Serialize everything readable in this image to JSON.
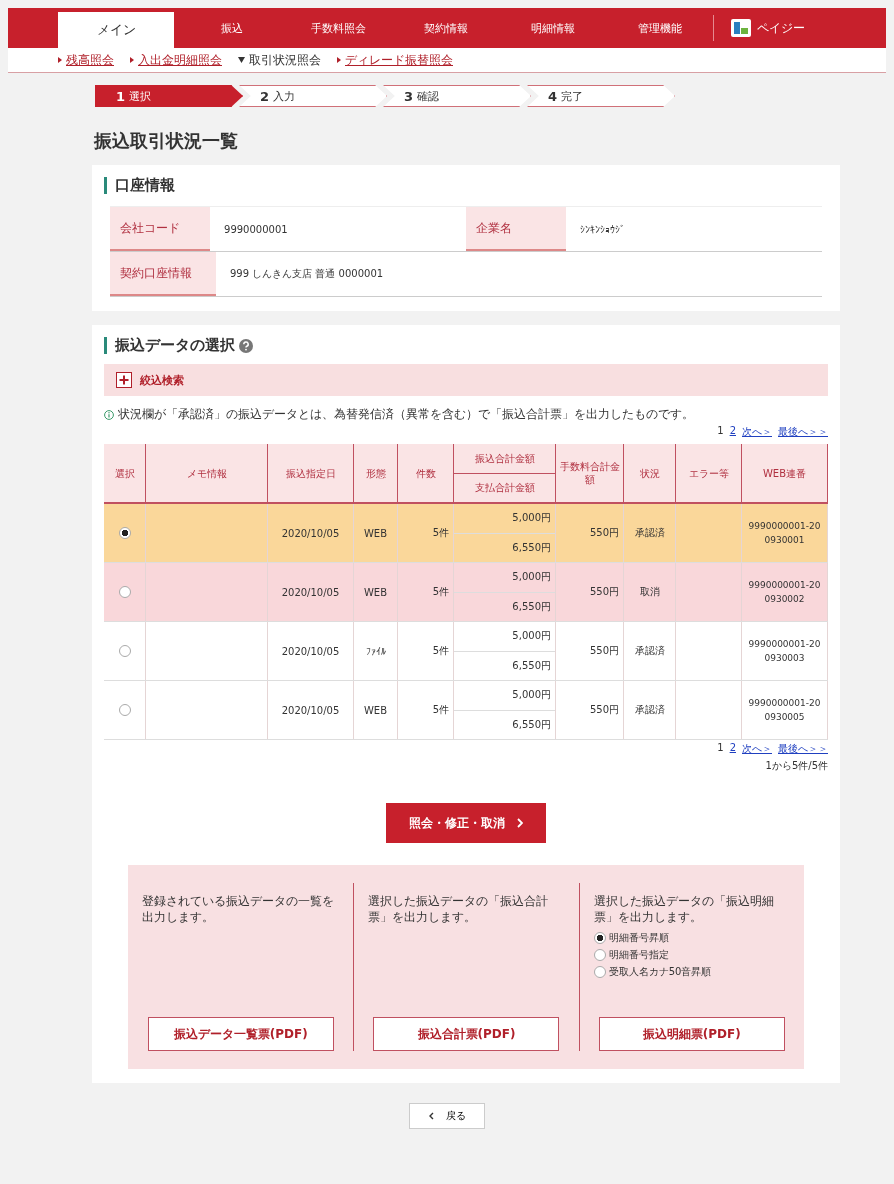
{
  "nav": [
    {
      "label": "メイン",
      "selected": true
    },
    {
      "label": "振込",
      "selected": false
    },
    {
      "label": "手数料照会",
      "selected": false
    },
    {
      "label": "契約情報",
      "selected": false
    },
    {
      "label": "明細情報",
      "selected": false
    },
    {
      "label": "管理機能",
      "selected": false
    }
  ],
  "nav_pay": {
    "label": "ペイジー"
  },
  "subnav": [
    {
      "label": "残高照会",
      "selected": false
    },
    {
      "label": "入出金明細照会",
      "selected": false
    },
    {
      "label": "取引状況照会",
      "selected": true
    },
    {
      "label": "ディレード振替照会",
      "selected": false
    }
  ],
  "steps": [
    {
      "number": "1",
      "label": "選択",
      "selected": true
    },
    {
      "number": "2",
      "label": "入力",
      "selected": false
    },
    {
      "number": "3",
      "label": "確認",
      "selected": false
    },
    {
      "number": "4",
      "label": "完了",
      "selected": false
    }
  ],
  "page_title": "振込取引状況一覧",
  "account": {
    "title": "口座情報",
    "fields": [
      {
        "label": "会社コード",
        "value": "9990000001"
      },
      {
        "label": "企業名",
        "value": "ｼﾝｷﾝｼｮｳｼﾞ"
      },
      {
        "label": "契約口座情報",
        "value": "999 しんきん支店 普通 0000001"
      }
    ]
  },
  "selection": {
    "title": "振込データの選択",
    "filter": "絞込検索",
    "note": "状況欄が「承認済」の振込データとは、為替発信済（異常を含む）で「振込合計票」を出力したものです。",
    "pager_top": {
      "pages": [
        "1",
        "2"
      ],
      "next": "次へ＞",
      "last": "最後へ＞＞"
    },
    "columns": [
      "選択",
      "メモ情報",
      "振込指定日",
      "形態",
      "件数",
      "振込合計金額",
      "支払合計金額",
      "手数料合計金額",
      "状況",
      "エラー等",
      "WEB連番"
    ],
    "rows": [
      {
        "selected": true,
        "cancelled": false,
        "memo": "",
        "date": "2020/10/05",
        "type": "WEB",
        "count": "5件",
        "transfer_total": "5,000円",
        "payment_total": "6,550円",
        "fee": "550円",
        "status": "承認済",
        "web_no": "9990000001-200930001"
      },
      {
        "selected": false,
        "cancelled": true,
        "memo": "",
        "date": "2020/10/05",
        "type": "WEB",
        "count": "5件",
        "transfer_total": "5,000円",
        "payment_total": "6,550円",
        "fee": "550円",
        "status": "取消",
        "web_no": "9990000001-200930002"
      },
      {
        "selected": false,
        "cancelled": false,
        "memo": "",
        "date": "2020/10/05",
        "type": "ﾌｧｲﾙ",
        "count": "5件",
        "transfer_total": "5,000円",
        "payment_total": "6,550円",
        "fee": "550円",
        "status": "承認済",
        "web_no": "9990000001-200930003"
      },
      {
        "selected": false,
        "cancelled": false,
        "memo": "",
        "date": "2020/10/05",
        "type": "WEB",
        "count": "5件",
        "transfer_total": "5,000円",
        "payment_total": "6,550円",
        "fee": "550円",
        "status": "承認済",
        "web_no": "9990000001-200930005"
      }
    ],
    "pager_bottom": {
      "pages": [
        "1",
        "2"
      ],
      "next": "次へ＞",
      "last": "最後へ＞＞",
      "summary": "1から5件/5件"
    },
    "action": "照会・修正・取消"
  },
  "outputs": [
    {
      "kind": "plain",
      "text": "登録されている振込データの一覧を出力します。",
      "button": "振込データ一覧票(PDF)"
    },
    {
      "kind": "plain",
      "text": "選択した振込データの「振込合計票」を出力します。",
      "button": "振込合計票(PDF)"
    },
    {
      "kind": "options",
      "text": "選択した振込データの「振込明細票」を出力します。",
      "options": [
        {
          "label": "明細番号昇順",
          "selected": true
        },
        {
          "label": "明細番号指定",
          "selected": false
        },
        {
          "label": "受取人名カナ50音昇順",
          "selected": false
        }
      ],
      "button": "振込明細票(PDF)"
    }
  ],
  "back": "戻る"
}
